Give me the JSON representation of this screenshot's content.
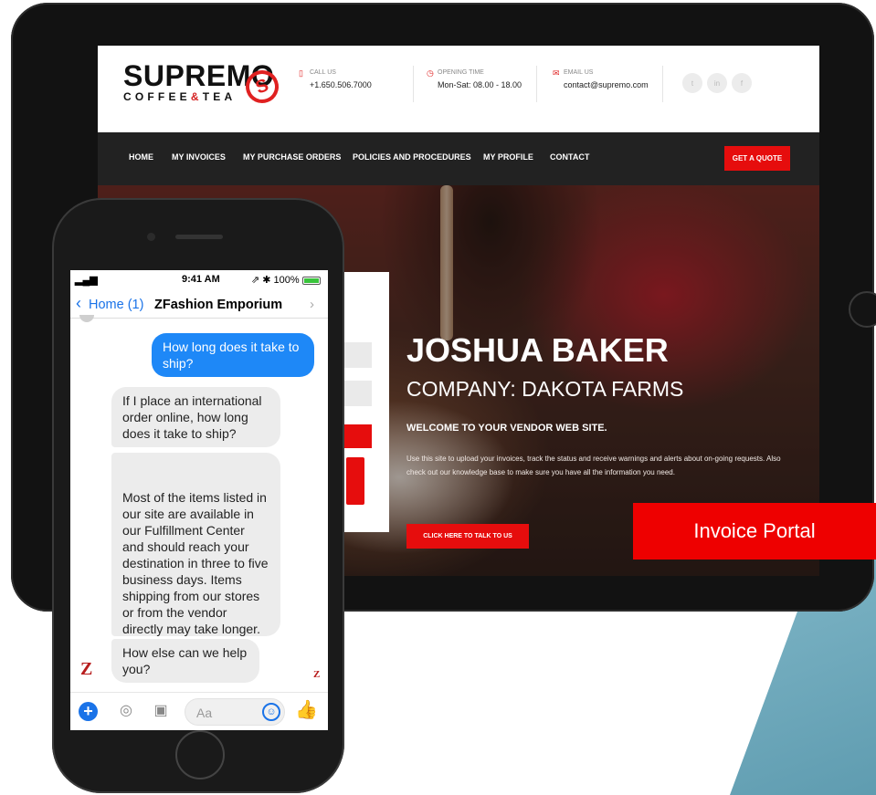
{
  "site": {
    "logo": {
      "name": "SUPREMO",
      "sub_a": "COFFEE",
      "sub_amp": "&",
      "sub_b": "TEA"
    },
    "header": {
      "call": {
        "label": "CALL US",
        "value": "+1.650.506.7000"
      },
      "opening": {
        "label": "OPENING TIME",
        "value": "Mon-Sat: 08.00 - 18.00"
      },
      "email": {
        "label": "EMAIL US",
        "value": "contact@supremo.com"
      },
      "social": [
        "twitter-icon",
        "linkedin-icon",
        "facebook-icon"
      ]
    },
    "nav": {
      "items": [
        "HOME",
        "MY INVOICES",
        "MY PURCHASE ORDERS",
        "POLICIES AND PROCEDURES",
        "MY PROFILE",
        "CONTACT"
      ],
      "quote_button": "GET A QUOTE"
    },
    "hero": {
      "name": "JOSHUA BAKER",
      "company": "COMPANY: DAKOTA FARMS",
      "welcome": "WELCOME TO YOUR VENDOR WEB SITE.",
      "description": "Use this site to upload your invoices, track the status and receive warnings and alerts about on-going requests. Also check out our knowledge base to make sure you have all the information you need.",
      "cta": "CLICK HERE TO TALK TO US"
    }
  },
  "badge": {
    "label": "Invoice Portal"
  },
  "phone": {
    "status": {
      "signal": "▂▄▆ ",
      "time": "9:41 AM",
      "right": "⇗ ✱ 100%"
    },
    "header": {
      "back": "Home (1)",
      "title": "ZFashion Emporium"
    },
    "messages": [
      {
        "from": "user",
        "text": "How long does it take to ship?"
      },
      {
        "from": "bot",
        "text": "If I place an international order online, how long does it take to ship?"
      },
      {
        "from": "bot",
        "text": "Most of the items listed in our site are available in our Fulfillment Center and should reach your destination in three to five business days. Items shipping from our stores or from the vendor directly may take longer."
      },
      {
        "from": "bot",
        "text": "How else can we help you?"
      }
    ],
    "composer": {
      "placeholder": "Aa"
    }
  },
  "colors": {
    "brand_red": "#e60d0d",
    "messenger_blue": "#1e88f7",
    "teal": "#6aa8bb"
  }
}
